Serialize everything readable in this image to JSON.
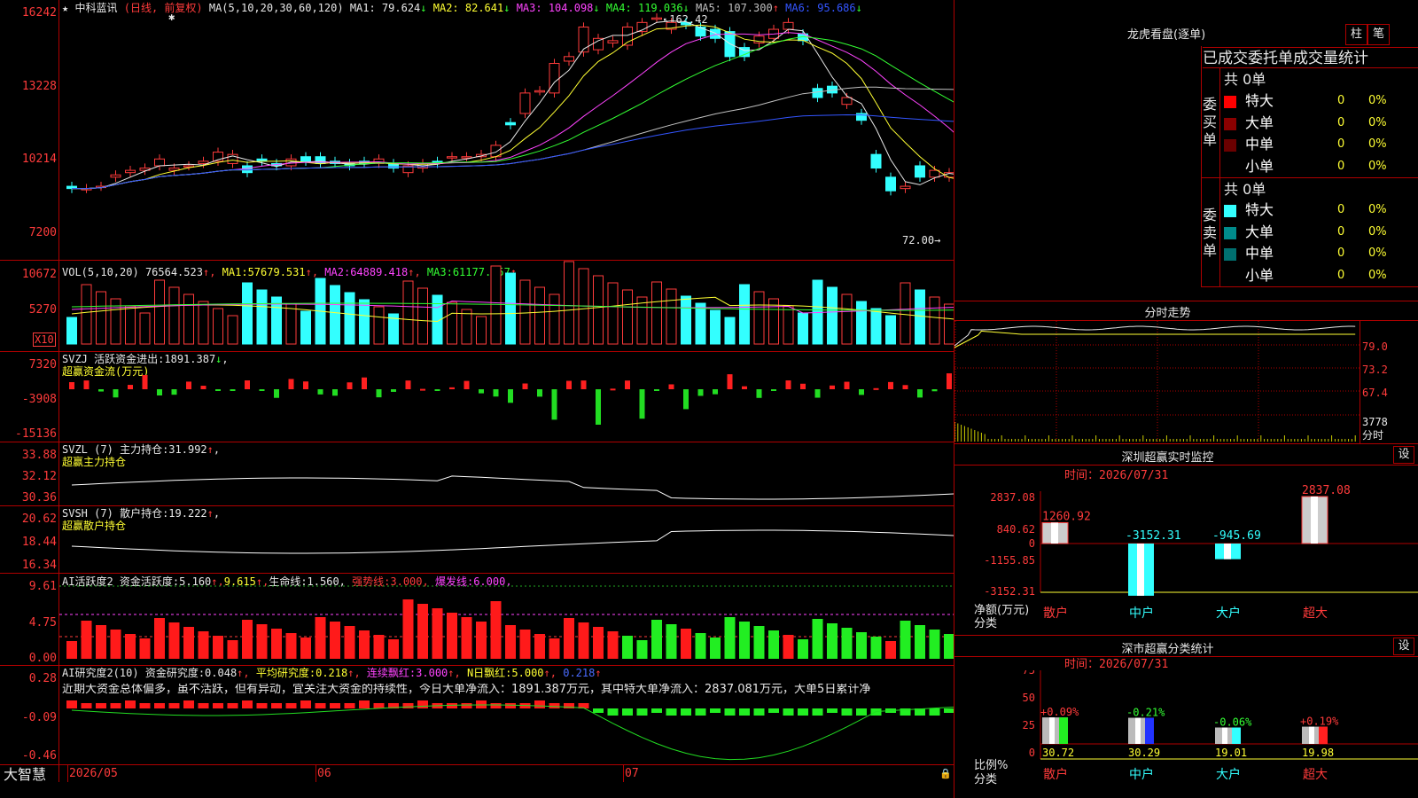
{
  "stock": {
    "name": "中科蓝讯",
    "mode": "(日线, 前复权)"
  },
  "main_chart": {
    "axis": [
      "16242",
      "13228",
      "10214",
      "7200"
    ],
    "ma_header": "MA(5,10,20,30,60,120)",
    "ma": [
      {
        "label": "MA1:",
        "value": "79.624",
        "arrow": "↓",
        "color": "#e8e8e8"
      },
      {
        "label": "MA2:",
        "value": "82.641",
        "arrow": "↓",
        "color": "#ffff33"
      },
      {
        "label": "MA3:",
        "value": "104.098",
        "arrow": "↓",
        "color": "#ff44ff"
      },
      {
        "label": "MA4:",
        "value": "119.036",
        "arrow": "↓",
        "color": "#33ff33"
      },
      {
        "label": "MA5:",
        "value": "107.300",
        "arrow": "↑",
        "color": "#c0c0c0"
      },
      {
        "label": "MA6:",
        "value": "95.686",
        "arrow": "↓",
        "color": "#3355ff"
      }
    ],
    "high_label": "162.42",
    "low_label": "72.00",
    "candles_open": [
      86,
      85,
      86,
      90,
      92,
      93,
      95,
      93,
      95,
      96,
      97,
      96,
      95,
      98,
      96,
      95,
      99,
      99,
      97,
      96,
      97,
      96,
      96,
      92,
      94,
      97,
      99,
      99,
      99,
      99,
      114,
      118,
      128,
      127,
      141,
      145,
      146,
      149,
      148,
      154,
      160,
      155,
      158,
      156,
      155,
      154,
      147,
      149,
      151,
      155,
      153,
      129,
      130,
      122,
      118,
      100,
      90,
      85,
      95,
      90,
      90,
      87,
      85,
      86,
      83
    ],
    "candles_close": [
      85,
      85,
      86,
      91,
      93,
      94,
      98,
      94,
      95,
      97,
      101,
      100,
      92,
      97,
      95,
      98,
      97,
      96,
      96,
      95,
      96,
      98,
      94,
      95,
      96,
      96,
      99,
      99,
      100,
      104,
      113,
      127,
      128,
      140,
      143,
      156,
      151,
      150,
      156,
      158,
      160,
      158,
      157,
      152,
      151,
      143,
      143,
      152,
      155,
      158,
      150,
      125,
      127,
      125,
      115,
      94,
      84,
      86,
      90,
      93,
      92,
      87,
      82,
      81,
      80
    ],
    "candles_up": [
      false,
      false,
      true,
      true,
      true,
      true,
      true,
      true,
      false,
      true,
      true,
      true,
      false,
      true,
      false,
      true,
      false,
      false,
      false,
      false,
      false,
      true,
      false,
      true,
      true,
      false,
      true,
      false,
      true,
      true,
      false,
      true,
      true,
      true,
      true,
      true,
      false,
      true,
      true,
      true,
      false,
      true,
      false,
      false,
      false,
      false,
      true,
      true,
      true,
      true,
      false,
      false,
      false,
      true,
      false,
      false,
      false,
      true,
      false,
      true,
      true,
      false,
      false,
      false,
      false
    ]
  },
  "vol_chart": {
    "axis": [
      "10672",
      "5270"
    ],
    "multiplier": "X10",
    "header": "VOL(5,10,20)",
    "value": "76564.523",
    "arrow": "↑",
    "ma1": "57679.531",
    "ma2": "64889.418",
    "ma3": "61177.957"
  },
  "svzj": {
    "axis": [
      "7320",
      "-3908",
      "-15136"
    ],
    "name": "SVZJ",
    "label": "活跃资金进出:",
    "value": "1891.387",
    "arrow": "↓",
    "sub": "超赢资金流(万元)"
  },
  "svzl": {
    "axis": [
      "33.88",
      "32.12",
      "30.36"
    ],
    "name": "SVZL",
    "period": "(7)",
    "label": "主力持仓:",
    "value": "31.992",
    "arrow": "↑",
    "sub": "超赢主力持仓"
  },
  "svsh": {
    "axis": [
      "20.62",
      "18.44",
      "16.34"
    ],
    "name": "SVSH",
    "period": "(7)",
    "label": "散户持仓:",
    "value": "19.222",
    "arrow": "↑",
    "sub": "超赢散户持仓"
  },
  "ai_active": {
    "axis": [
      "9.61",
      "4.75",
      "0.00"
    ],
    "name": "AI活跃度2",
    "label": "资金活跃度:",
    "value": "5.160",
    "v2": "9.615",
    "life_label": "生命线:",
    "life": "1.560",
    "strong_label": "强势线:",
    "strong": "3.000",
    "burst_label": "爆发线:",
    "burst": "6.000"
  },
  "ai_research": {
    "axis": [
      "0.28",
      "-0.09",
      "-0.46"
    ],
    "name": "AI研究度2(10)",
    "label": "资金研究度:",
    "value": "0.048",
    "avg_label": "平均研究度:",
    "avg": "0.218",
    "streak_label": "连续飘红:",
    "streak": "3.000",
    "nday_label": "N日飘红:",
    "nday": "5.000",
    "extra": "0.218",
    "comment": "近期大资金总体偏多，虽不活跃，但有异动，宜关注大资金的持续性，今日大单净流入：1891.387万元，其中特大单净流入：2837.081万元，大单5日累计净"
  },
  "xaxis": {
    "brand": "大智慧",
    "labels": [
      "2026/05",
      "06",
      "07"
    ]
  },
  "lhkp": {
    "title": "龙虎看盘(逐单)",
    "tab1": "柱",
    "tab2": "笔",
    "heading": "已成交委托单成交量统计",
    "buy": {
      "side": "委买单",
      "total": "共 0单",
      "rows": [
        {
          "label": "特大",
          "color": "#ff0000",
          "value": "0",
          "pct": "0%"
        },
        {
          "label": "大单",
          "color": "#8b0000",
          "value": "0",
          "pct": "0%"
        },
        {
          "label": "中单",
          "color": "#6b0000",
          "value": "0",
          "pct": "0%"
        },
        {
          "label": "小单",
          "color": "#000000",
          "value": "0",
          "pct": "0%"
        }
      ]
    },
    "sell": {
      "side": "委卖单",
      "total": "共 0单",
      "rows": [
        {
          "label": "特大",
          "color": "#33ffff",
          "value": "0",
          "pct": "0%"
        },
        {
          "label": "大单",
          "color": "#008b8b",
          "value": "0",
          "pct": "0%"
        },
        {
          "label": "中单",
          "color": "#007070",
          "value": "0",
          "pct": "0%"
        },
        {
          "label": "小单",
          "color": "#000000",
          "value": "0",
          "pct": "0%"
        }
      ]
    }
  },
  "fenshi": {
    "title": "分时走势",
    "axis": [
      "79.0",
      "73.2",
      "67.4",
      "3778",
      "分时"
    ]
  },
  "monitor": {
    "title": "深圳超赢实时监控",
    "btn": "设",
    "time": "时间：2026/07/31",
    "axis": [
      "2837.08",
      "840.62",
      "0",
      "-1155.85",
      "-3152.31"
    ],
    "ylab1": "净额(万元)",
    "ylab2": "分类",
    "chart_data": {
      "type": "bar",
      "categories": [
        "散户",
        "中户",
        "大户",
        "超大"
      ],
      "values": [
        1260.92,
        -3152.31,
        -945.69,
        2837.08
      ],
      "labels": [
        "1260.92",
        "-3152.31",
        "-945.69",
        "2837.08"
      ],
      "ylim": [
        -3152.31,
        2837.08
      ]
    }
  },
  "classify": {
    "title": "深市超赢分类统计",
    "btn": "设",
    "time": "时间：2026/07/31",
    "axis": [
      "75",
      "50",
      "25",
      "0"
    ],
    "ylab1": "比例%",
    "ylab2": "分类",
    "chart_data": {
      "type": "bar",
      "categories": [
        "散户",
        "中户",
        "大户",
        "超大"
      ],
      "values": [
        30.72,
        30.29,
        19.01,
        19.98
      ],
      "changes": [
        "+0.09%",
        "-0.21%",
        "-0.06%",
        "+0.19%"
      ],
      "ylim": [
        0,
        75
      ]
    }
  }
}
